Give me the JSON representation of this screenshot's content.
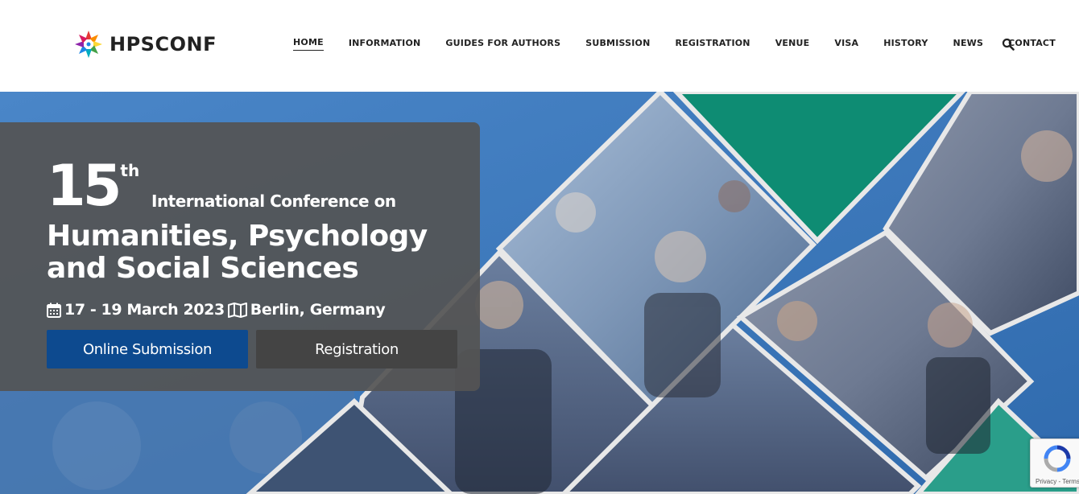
{
  "brand": {
    "name": "HPSCONF"
  },
  "nav": {
    "items": [
      {
        "label": "HOME",
        "active": true
      },
      {
        "label": "INFORMATION",
        "active": false
      },
      {
        "label": "GUIDES FOR AUTHORS",
        "active": false
      },
      {
        "label": "SUBMISSION",
        "active": false
      },
      {
        "label": "REGISTRATION",
        "active": false
      },
      {
        "label": "VENUE",
        "active": false
      },
      {
        "label": "VISA",
        "active": false
      },
      {
        "label": "HISTORY",
        "active": false
      },
      {
        "label": "NEWS",
        "active": false
      },
      {
        "label": "CONTACT",
        "active": false
      }
    ],
    "search_icon": "search-icon"
  },
  "hero": {
    "edition_number": "15",
    "edition_suffix": "th",
    "title_prefix": "International Conference on",
    "title": "Humanities, Psychology and Social Sciences",
    "dates": "17 - 19 March 2023",
    "location": "Berlin, Germany",
    "date_icon": "calendar-icon",
    "location_icon": "map-icon",
    "submit_label": "Online Submission",
    "register_label": "Registration"
  },
  "recaptcha": {
    "footer": "Privacy - Terms"
  },
  "colors": {
    "primary": "#0d4a8f",
    "secondary": "#444444",
    "teal": "#0e8c73",
    "hero_blue": "#3d7ac0",
    "card": "#545454"
  }
}
